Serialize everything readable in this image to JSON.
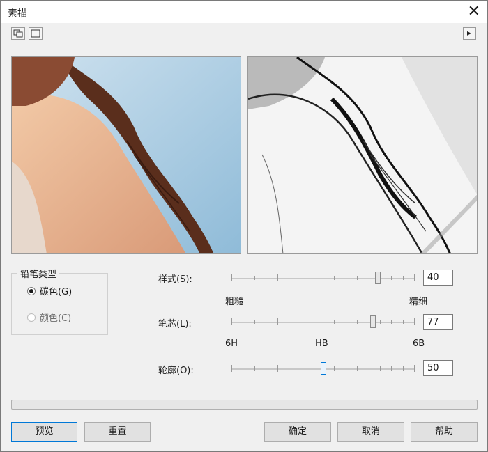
{
  "window": {
    "title": "素描",
    "close_glyph": "✕"
  },
  "toolbar": {
    "icons": [
      "preview-split-icon",
      "preview-single-icon"
    ],
    "expand_glyph": "▸"
  },
  "pencil_type": {
    "title": "铅笔类型",
    "options": [
      {
        "label": "碳色(G)",
        "checked": true
      },
      {
        "label": "颜色(C)",
        "checked": false
      }
    ]
  },
  "sliders": {
    "style": {
      "label": "样式(S):",
      "value": "40",
      "min_label": "粗糙",
      "max_label": "精细",
      "level_pct": 80
    },
    "lead": {
      "label": "笔芯(L):",
      "value": "77",
      "min_label": "6H",
      "mid_label": "HB",
      "max_label": "6B",
      "level_pct": 77
    },
    "outline": {
      "label": "轮廓(O):",
      "value": "50",
      "level_pct": 50
    }
  },
  "buttons": {
    "preview": "预览",
    "reset": "重置",
    "ok": "确定",
    "cancel": "取消",
    "help": "帮助"
  }
}
